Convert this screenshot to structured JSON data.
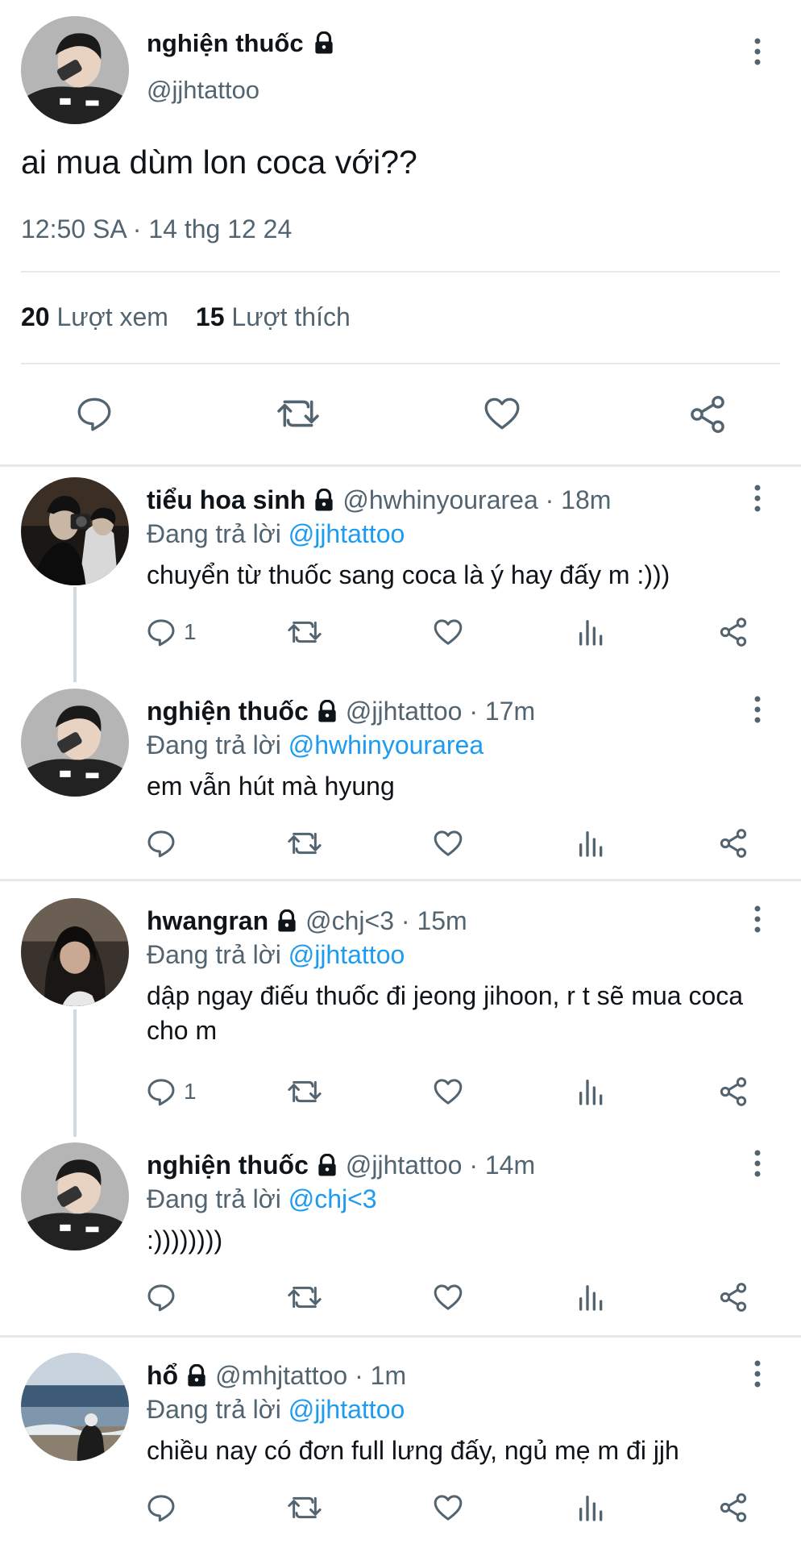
{
  "main_tweet": {
    "name": "nghiện thuốc",
    "handle": "@jjhtattoo",
    "text": "ai mua dùm lon coca với??",
    "timestamp": "12:50 SA · 14 thg 12 24",
    "views_count": "20",
    "views_label": "Lượt xem",
    "likes_count": "15",
    "likes_label": "Lượt thích",
    "icons": [
      "reply-icon",
      "retweet-icon",
      "like-icon",
      "share-icon"
    ]
  },
  "replies": [
    {
      "name": "tiểu hoa sinh",
      "handle": "@hwhinyourarea · 18m",
      "replying_prefix": "Đang trả lời",
      "replying_to": "@jjhtattoo",
      "text": "chuyển từ thuốc sang coca là ý hay đấy m :)))",
      "reply_count": "1"
    },
    {
      "name": "nghiện thuốc",
      "handle": "@jjhtattoo · 17m",
      "replying_prefix": "Đang trả lời",
      "replying_to": "@hwhinyourarea",
      "text": "em vẫn hút mà hyung",
      "reply_count": ""
    },
    {
      "name": "hwangran",
      "handle": "@chj<3 · 15m",
      "replying_prefix": "Đang trả lời",
      "replying_to": "@jjhtattoo",
      "text": "dập ngay điếu thuốc đi jeong jihoon, r t sẽ mua coca cho m",
      "reply_count": "1"
    },
    {
      "name": "nghiện thuốc",
      "handle": "@jjhtattoo · 14m",
      "replying_prefix": "Đang trả lời",
      "replying_to": "@chj<3",
      "text": ":))))))))",
      "reply_count": ""
    },
    {
      "name": "hổ",
      "handle": "@mhjtattoo · 1m",
      "replying_prefix": "Đang trả lời",
      "replying_to": "@jjhtattoo",
      "text": "chiều nay có đơn full lưng đấy, ngủ mẹ m đi jjh",
      "reply_count": ""
    }
  ],
  "colors": {
    "text_primary": "#0f1419",
    "text_secondary": "#536471",
    "mention": "#1d9bf0",
    "divider": "#e6e9eb",
    "thread_line": "#cfd9de"
  }
}
